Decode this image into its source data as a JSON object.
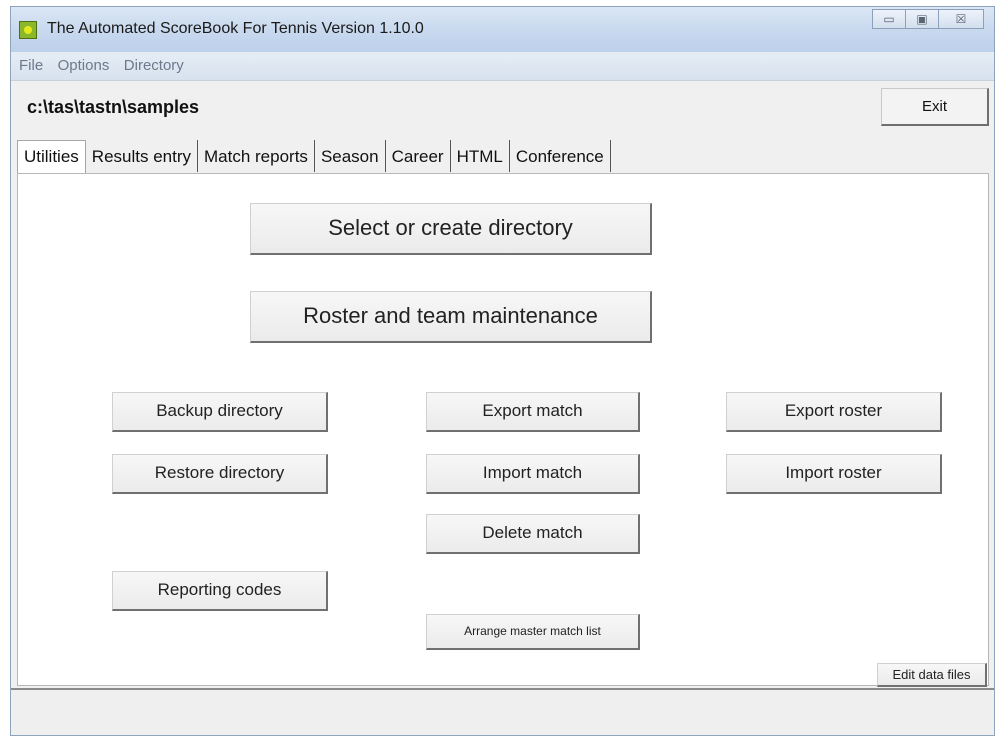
{
  "window": {
    "title": "The Automated ScoreBook For Tennis  Version 1.10.0",
    "controls": {
      "minimize": "▭",
      "maximize": "▣",
      "close": "☒"
    }
  },
  "menu": [
    "File",
    "Options",
    "Directory"
  ],
  "path": "c:\\tas\\tastn\\samples",
  "exit_label": "Exit",
  "tabs": [
    "Utilities",
    "Results entry",
    "Match reports",
    "Season",
    "Career",
    "HTML",
    "Conference"
  ],
  "active_tab": "Utilities",
  "buttons": {
    "select_dir": "Select or create directory",
    "roster_maint": "Roster and team maintenance",
    "backup_dir": "Backup directory",
    "restore_dir": "Restore directory",
    "reporting_codes": "Reporting codes",
    "export_match": "Export match",
    "import_match": "Import match",
    "delete_match": "Delete match",
    "arrange_list": "Arrange master match list",
    "export_roster": "Export roster",
    "import_roster": "Import roster",
    "edit_data_files": "Edit data files"
  },
  "icons": {
    "app": "tennis-ball-app-icon"
  },
  "colors": {
    "titlebar": "#c7d8ee",
    "panel": "#ffffff",
    "menu_text": "#6b7a8c"
  }
}
